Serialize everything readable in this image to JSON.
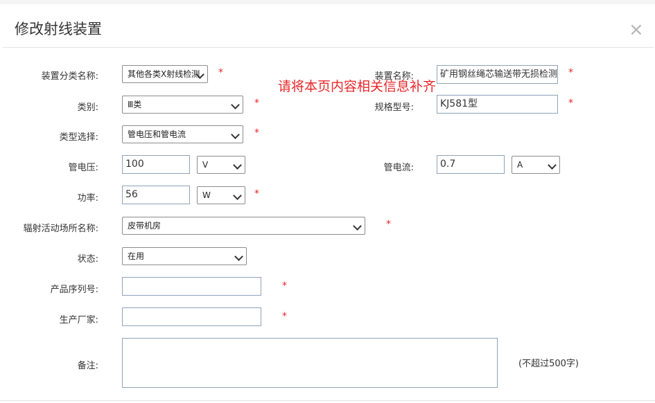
{
  "dialog": {
    "title": "修改射线装置",
    "close_glyph": "×"
  },
  "notice": "请将本页内容相关信息补齐",
  "required_mark": "*",
  "fields": {
    "device_category": {
      "label": "装置分类名称:",
      "value": "其他各类X射线检测"
    },
    "device_name": {
      "label": "装置名称:",
      "value": "矿用钢丝绳芯输送带无损检测"
    },
    "class": {
      "label": "类别:",
      "value": "Ⅲ类"
    },
    "model": {
      "label": "规格型号:",
      "value": "KJ581型"
    },
    "type_select": {
      "label": "类型选择:",
      "value": "管电压和管电流"
    },
    "tube_voltage": {
      "label": "管电压:",
      "value": "100",
      "unit": "V"
    },
    "tube_current": {
      "label": "管电流:",
      "value": "0.7",
      "unit": "A"
    },
    "power": {
      "label": "功率:",
      "value": "56",
      "unit": "W"
    },
    "radiation_site": {
      "label": "辐射活动场所名称:",
      "value": "皮带机房"
    },
    "status": {
      "label": "状态:",
      "value": "在用"
    },
    "serial": {
      "label": "产品序列号:",
      "value": ""
    },
    "manufacturer": {
      "label": "生产厂家:",
      "value": ""
    },
    "remark": {
      "label": "备注:",
      "value": "",
      "hint": "(不超过500字)"
    }
  },
  "icons": {
    "close": "close-icon",
    "dropdown": "chevron-down-icon"
  },
  "colors": {
    "required": "#e8262a",
    "border": "#8c8c8c"
  }
}
